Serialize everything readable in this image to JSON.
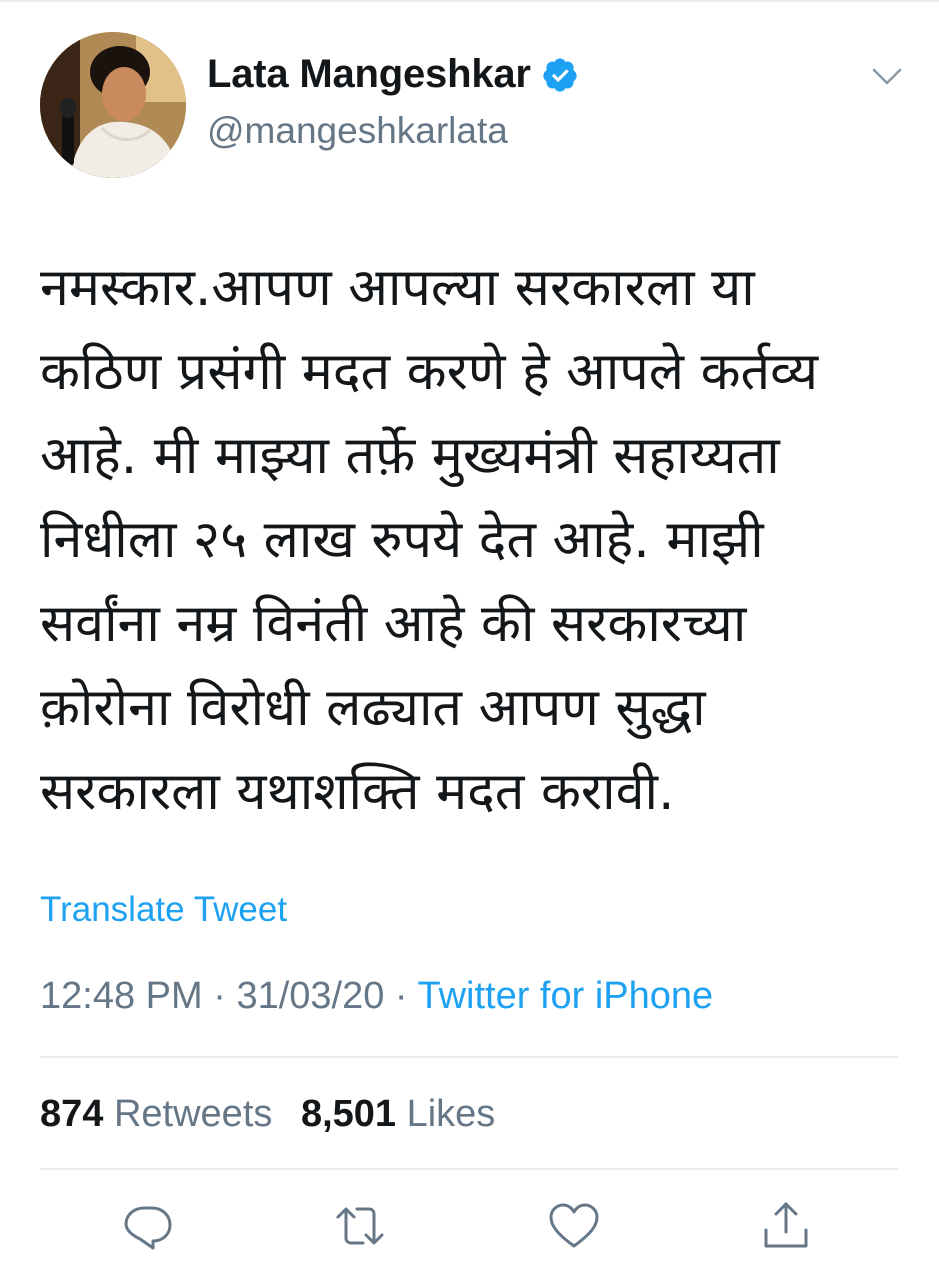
{
  "author": {
    "display_name": "Lata Mangeshkar",
    "handle": "@mangeshkarlata",
    "verified_icon": "verified-badge-icon",
    "avatar": "profile-photo"
  },
  "tweet": {
    "text": "नमस्कार.आपण आपल्या सरकारला या\nकठिण प्रसंगी मदत करणे हे आपले कर्तव्य\nआहे. मी माझ्या तर्फ़े मुख्यमंत्री सहाय्यता\nनिधीला २५ लाख रुपये देत आहे. माझी\nसर्वांना नम्र विनंती आहे की सरकारच्या\nक़ोरोना विरोधी लढ्यात आपण सुद्धा\nसरकारला यथाशक्ति मदत करावी.",
    "translate_label": "Translate Tweet",
    "time": "12:48 PM",
    "separator": "·",
    "date": "31/03/20",
    "source": "Twitter for iPhone"
  },
  "stats": {
    "retweets_count": "874",
    "retweets_label": "Retweets",
    "likes_count": "8,501",
    "likes_label": "Likes"
  },
  "actions": [
    "reply-icon",
    "retweet-icon",
    "like-icon",
    "share-icon"
  ],
  "colors": {
    "accent": "#1da1f2",
    "muted": "#657786",
    "text": "#14171a",
    "divider": "#e6ecf0"
  }
}
